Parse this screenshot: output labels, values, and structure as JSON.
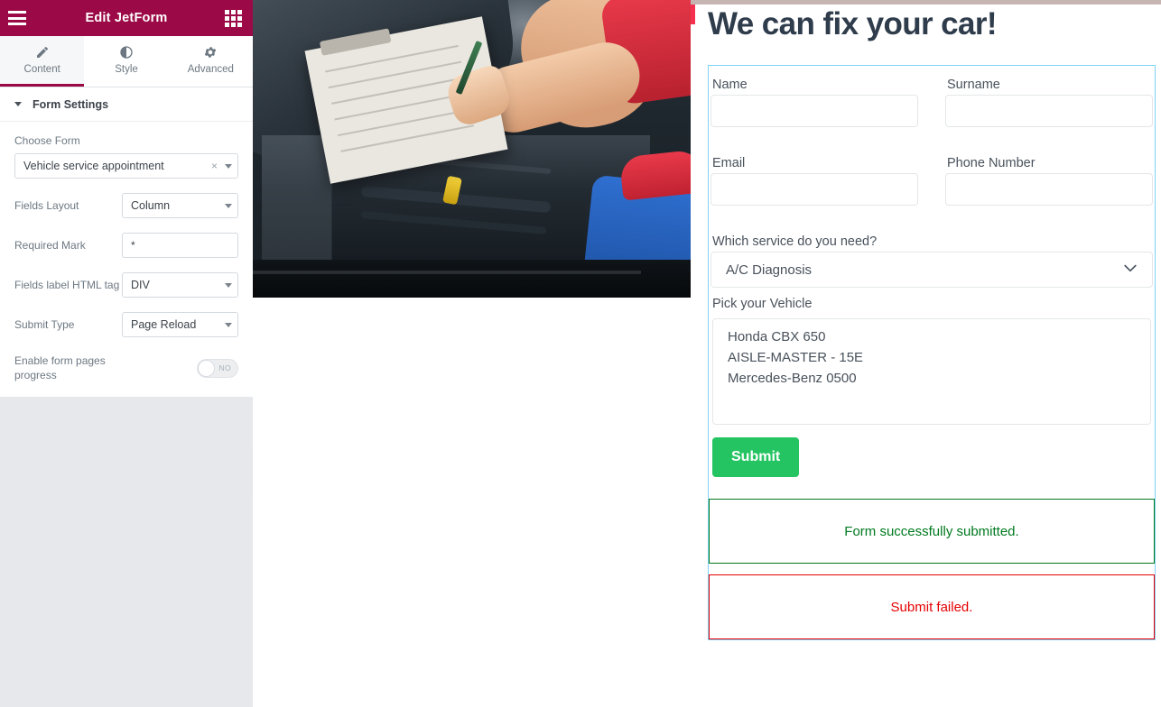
{
  "editor": {
    "header": {
      "title": "Edit JetForm",
      "menu_icon": "hamburger-icon",
      "apps_icon": "grid-icon"
    },
    "tabs": [
      {
        "label": "Content",
        "icon": "pencil-icon",
        "active": true
      },
      {
        "label": "Style",
        "icon": "contrast-icon",
        "active": false
      },
      {
        "label": "Advanced",
        "icon": "gear-icon",
        "active": false
      }
    ],
    "section": {
      "title": "Form Settings",
      "collapse_icon": "caret-down-icon"
    },
    "controls": {
      "choose_form": {
        "label": "Choose Form",
        "value": "Vehicle service appointment",
        "clear_icon": "close-icon",
        "dropdown_icon": "caret-down-icon"
      },
      "fields_layout": {
        "label": "Fields Layout",
        "value": "Column",
        "dropdown_icon": "caret-down-icon"
      },
      "required_mark": {
        "label": "Required Mark",
        "value": "*"
      },
      "fields_label_html_tag": {
        "label": "Fields label HTML tag",
        "value": "DIV",
        "dropdown_icon": "caret-down-icon"
      },
      "submit_type": {
        "label": "Submit Type",
        "value": "Page Reload",
        "dropdown_icon": "caret-down-icon"
      },
      "enable_form_pages_progress": {
        "label": "Enable form pages progress",
        "state_label": "NO",
        "enabled": false
      }
    },
    "collapse_handle": {
      "icon": "chevron-left-icon",
      "glyph": "‹"
    }
  },
  "preview": {
    "hero_image_alt": "mechanic-filling-checklist-under-car-hood",
    "form": {
      "heading": "We can fix your car!",
      "fields": [
        {
          "label": "Name",
          "value": "",
          "placeholder": ""
        },
        {
          "label": "Surname",
          "value": "",
          "placeholder": ""
        },
        {
          "label": "Email",
          "value": "",
          "placeholder": ""
        },
        {
          "label": "Phone Number",
          "value": "",
          "placeholder": ""
        }
      ],
      "service_select": {
        "label": "Which service do you need?",
        "value": "A/C Diagnosis",
        "dropdown_icon": "chevron-down-icon"
      },
      "vehicle_list": {
        "label": "Pick your Vehicle",
        "options": [
          "Honda CBX 650",
          "AISLE-MASTER - 15E",
          "Mercedes-Benz 0500"
        ]
      },
      "submit_label": "Submit",
      "messages": {
        "success": "Form successfully submitted.",
        "error": "Submit failed."
      }
    }
  },
  "colors": {
    "brand_maroon": "#9b0a46",
    "form_outline_cyan": "#7fd2f5",
    "submit_green": "#25c462",
    "success_green": "#007a1f",
    "error_red": "#e50000",
    "heading_navy": "#2f3c4c"
  }
}
